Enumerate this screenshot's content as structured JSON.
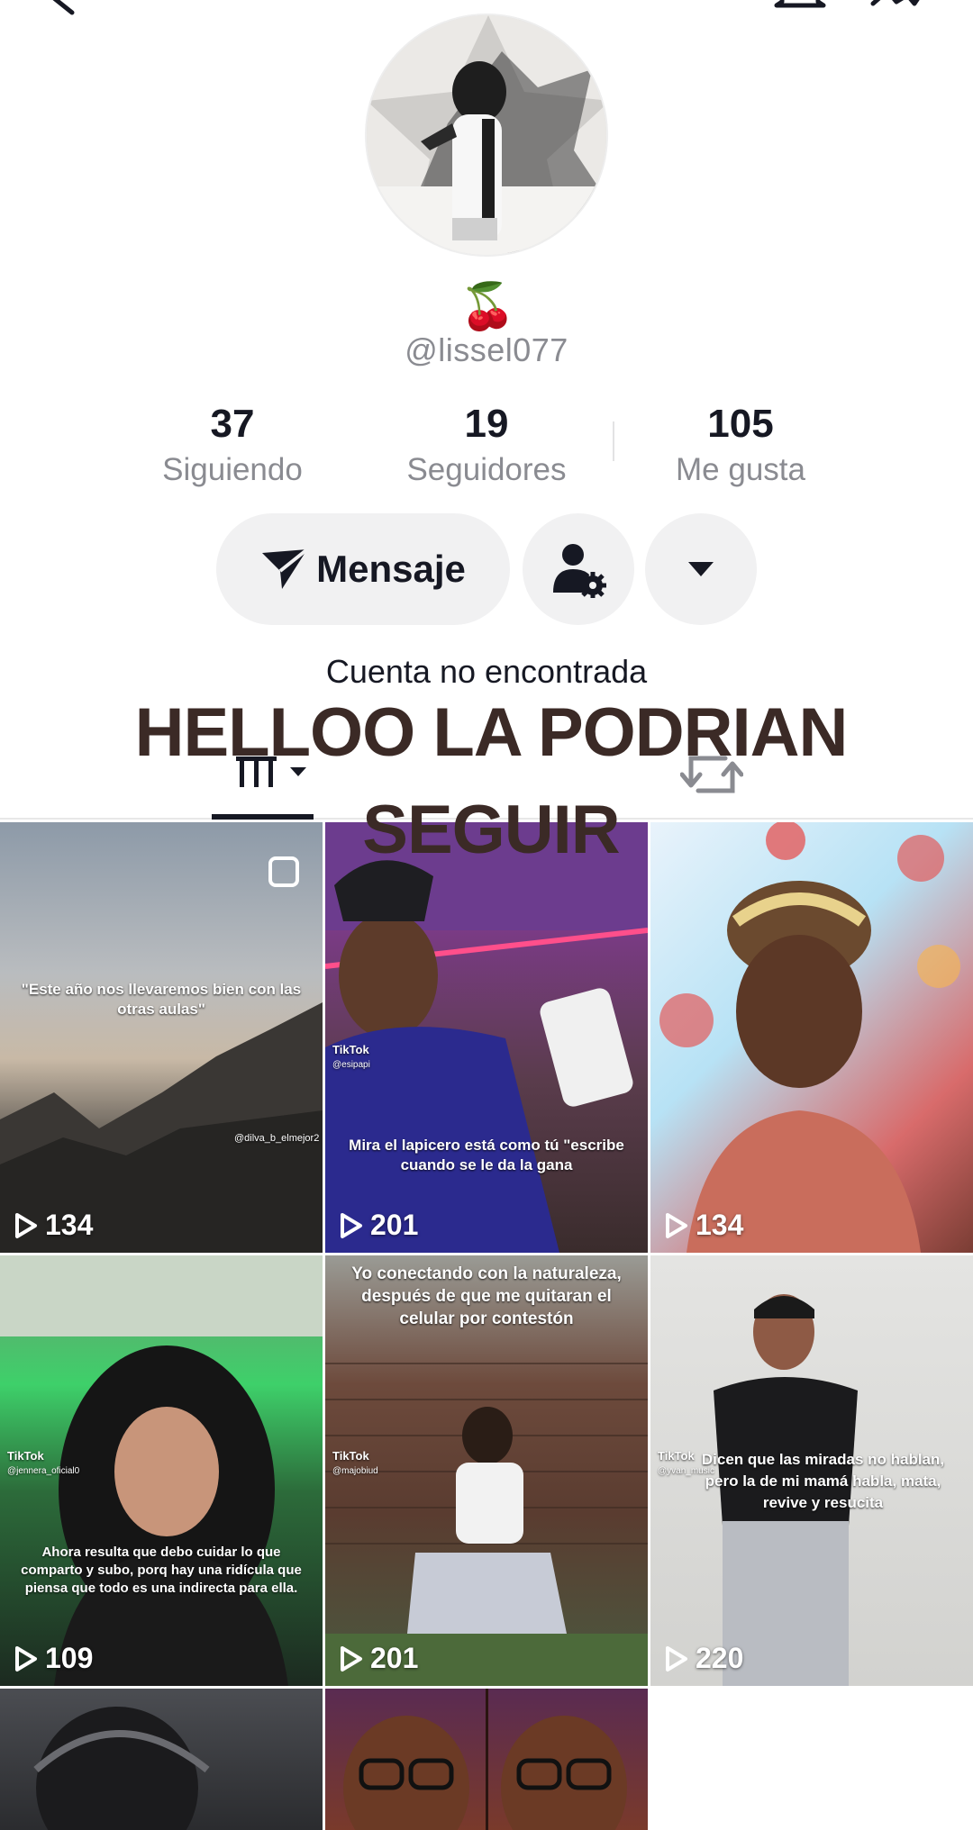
{
  "profile": {
    "emoji": "🍒",
    "handle": "@lissel077"
  },
  "stats": [
    {
      "value": "37",
      "label": "Siguiendo"
    },
    {
      "value": "19",
      "label": "Seguidores"
    },
    {
      "value": "105",
      "label": "Me gusta"
    }
  ],
  "actions": {
    "message_label": "Mensaje"
  },
  "account_status": "Cuenta no encontrada",
  "overlay": {
    "line1": "HELLOO LA PODRIAN",
    "line2": "SEGUIR"
  },
  "videos": [
    {
      "views": "134",
      "caption": "\"Este año nos llevaremos bien con las otras aulas\"",
      "watermark": "@dilva_b_elmejor2"
    },
    {
      "views": "201",
      "caption": "Mira el lapicero está como tú \"escribe cuando se le da la gana",
      "tiktok": "TikTok",
      "watermark": "@esipapi"
    },
    {
      "views": "134",
      "caption": ""
    },
    {
      "views": "109",
      "caption": "Ahora resulta que debo cuidar lo que comparto y subo, porq hay una ridícula que piensa que todo es una indirecta para ella.",
      "tiktok": "TikTok",
      "watermark": "@jennera_oficial0"
    },
    {
      "views": "201",
      "caption": "Yo conectando con la naturaleza, después de que me quitaran el celular por contestón",
      "tiktok": "TikTok",
      "watermark": "@majobiud"
    },
    {
      "views": "220",
      "caption": "Dicen que las miradas no hablan, pero la de mi mamá habla, mata, revive y resucita",
      "tiktok": "TikTok",
      "watermark": "@yvan_music"
    }
  ],
  "colors": {
    "stat_label": "#8a8b91",
    "button_bg": "#f1f1f2",
    "overlay_text": "#3b2a26",
    "text_primary": "#161823"
  }
}
